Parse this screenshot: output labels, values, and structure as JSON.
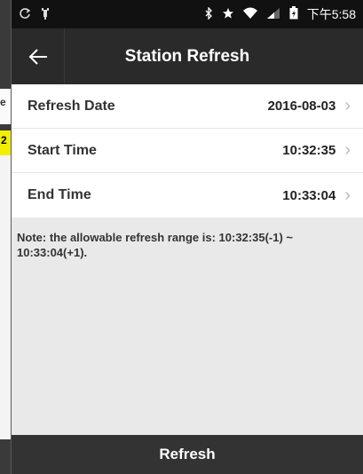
{
  "statusbar": {
    "left_icons": [
      "sync-icon",
      "usb-icon"
    ],
    "right_icons": [
      "bluetooth-icon",
      "star-icon",
      "wifi-icon",
      "signal-icon",
      "battery-icon"
    ],
    "time": "下午5:58"
  },
  "background": {
    "fragment_1": "e",
    "fragment_2": "2"
  },
  "header": {
    "title": "Station Refresh"
  },
  "rows": [
    {
      "label": "Refresh Date",
      "value": "2016-08-03"
    },
    {
      "label": "Start Time",
      "value": "10:32:35"
    },
    {
      "label": "End Time",
      "value": "10:33:04"
    }
  ],
  "note": "Note: the allowable refresh range is: 10:32:35(-1) ~ 10:33:04(+1).",
  "footer": {
    "button_label": "Refresh"
  },
  "colors": {
    "statusbar": "#111111",
    "appbar": "#2a2a2a",
    "panel_bg": "#e9e9e9",
    "button": "#333333"
  }
}
